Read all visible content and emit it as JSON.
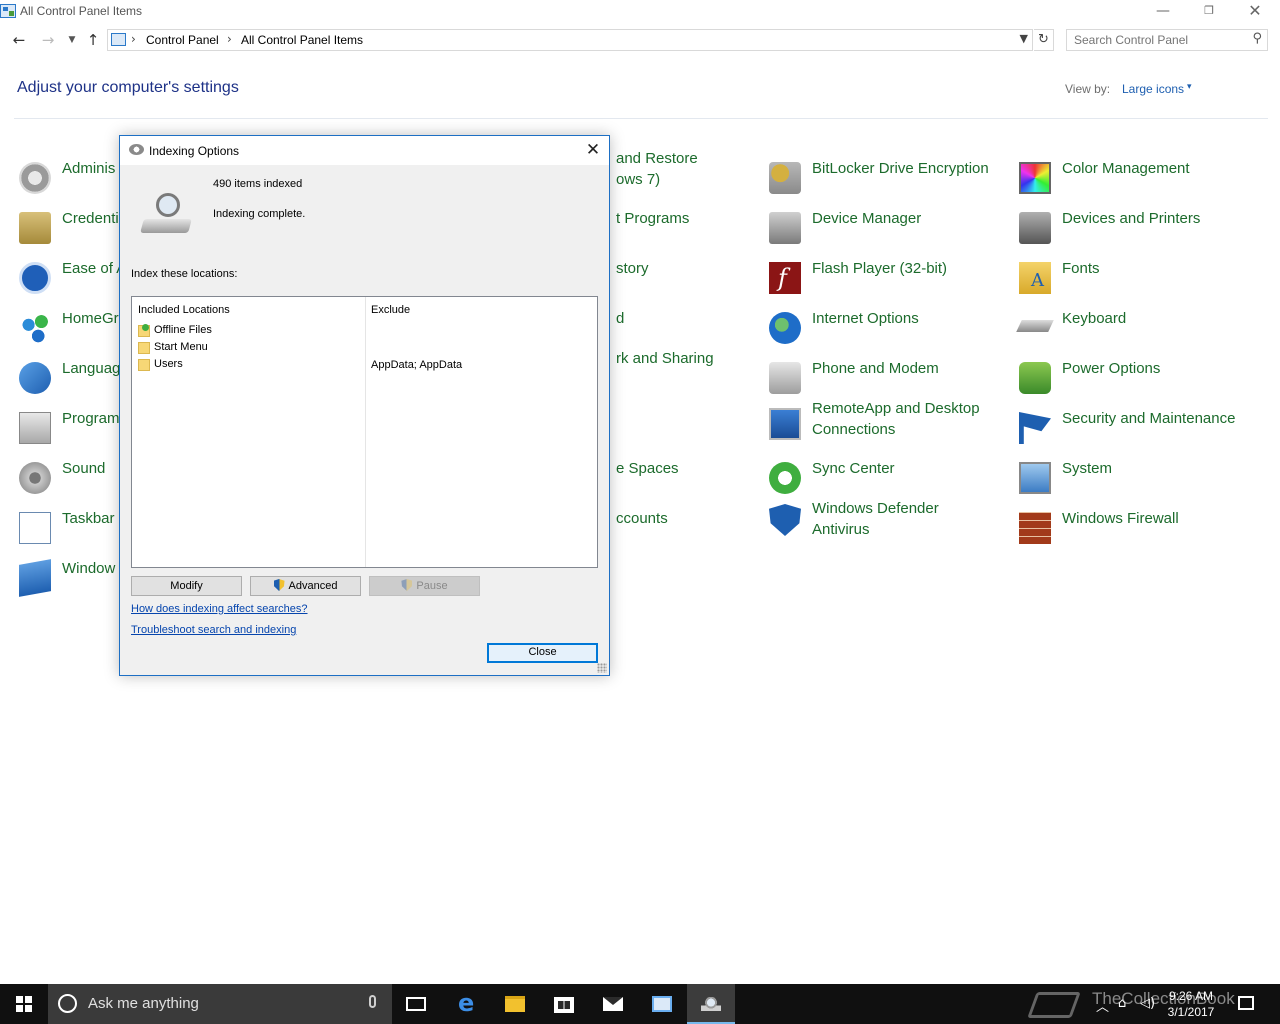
{
  "window": {
    "title": "All Control Panel Items",
    "controls": {
      "minimize": "—",
      "restore": "❐",
      "close": "✕"
    }
  },
  "nav": {
    "back": "←",
    "forward": "→",
    "recent": "▼",
    "up": "↑",
    "breadcrumb": [
      "Control Panel",
      "All Control Panel Items"
    ],
    "separator": "›",
    "refresh": "↻",
    "search_placeholder": "Search Control Panel",
    "search_icon": "⚲"
  },
  "header": {
    "title": "Adjust your computer's settings",
    "view_by_label": "View by:",
    "view_by_value": "Large icons",
    "view_by_arrow": "▾"
  },
  "items": {
    "col1": [
      {
        "label": "Adminis",
        "icon": "admin-tools-icon"
      },
      {
        "label": "Credenti",
        "icon": "credential-manager-icon"
      },
      {
        "label": "Ease of A",
        "icon": "ease-of-access-icon"
      },
      {
        "label": "HomeGr",
        "icon": "homegroup-icon"
      },
      {
        "label": "Languag",
        "icon": "language-icon"
      },
      {
        "label": "Program",
        "icon": "programs-icon"
      },
      {
        "label": "Sound",
        "icon": "sound-icon"
      },
      {
        "label": "Taskbar",
        "icon": "taskbar-icon"
      },
      {
        "label": "Window",
        "icon": "windows-to-go-icon"
      }
    ],
    "col2": [
      {
        "label": "and Restore"
      },
      {
        "label": "ows 7)"
      },
      {
        "label": "t Programs"
      },
      {
        "label": "story"
      },
      {
        "label": "d"
      },
      {
        "label": "rk and Sharing"
      },
      {
        "label": "e Spaces"
      },
      {
        "label": "ccounts"
      }
    ],
    "col3": [
      {
        "label": "BitLocker Drive Encryption",
        "icon": "bitlocker-icon"
      },
      {
        "label": "Device Manager",
        "icon": "device-manager-icon"
      },
      {
        "label": "Flash Player (32-bit)",
        "icon": "flash-player-icon"
      },
      {
        "label": "Internet Options",
        "icon": "internet-options-icon"
      },
      {
        "label": "Phone and Modem",
        "icon": "phone-modem-icon"
      },
      {
        "label": "RemoteApp and Desktop Connections",
        "icon": "remoteapp-icon"
      },
      {
        "label": "Sync Center",
        "icon": "sync-center-icon"
      },
      {
        "label": "Windows Defender Antivirus",
        "icon": "windows-defender-icon"
      }
    ],
    "col4": [
      {
        "label": "Color Management",
        "icon": "color-management-icon"
      },
      {
        "label": "Devices and Printers",
        "icon": "devices-printers-icon"
      },
      {
        "label": "Fonts",
        "icon": "fonts-icon"
      },
      {
        "label": "Keyboard",
        "icon": "keyboard-icon"
      },
      {
        "label": "Power Options",
        "icon": "power-options-icon"
      },
      {
        "label": "Security and Maintenance",
        "icon": "security-maintenance-icon"
      },
      {
        "label": "System",
        "icon": "system-icon"
      },
      {
        "label": "Windows Firewall",
        "icon": "windows-firewall-icon"
      }
    ]
  },
  "dialog": {
    "title": "Indexing Options",
    "close_glyph": "✕",
    "items_indexed": "490 items indexed",
    "status": "Indexing complete.",
    "index_label": "Index these locations:",
    "col_included": "Included Locations",
    "col_exclude": "Exclude",
    "locations": [
      {
        "name": "Offline Files",
        "exclude": ""
      },
      {
        "name": "Start Menu",
        "exclude": ""
      },
      {
        "name": "Users",
        "exclude": "AppData; AppData"
      }
    ],
    "buttons": {
      "modify": "Modify",
      "advanced": "Advanced",
      "pause": "Pause",
      "close": "Close"
    },
    "links": {
      "how": "How does indexing affect searches?",
      "troubleshoot": "Troubleshoot search and indexing"
    }
  },
  "taskbar": {
    "search_text": "Ask me anything",
    "edge_glyph": "e",
    "watermark": "TheCollectionBook",
    "tray_icons": {
      "chevron": "︿",
      "network": "⌂",
      "volume": "◁)"
    },
    "time": "9:26 AM",
    "date": "3/1/2017"
  }
}
